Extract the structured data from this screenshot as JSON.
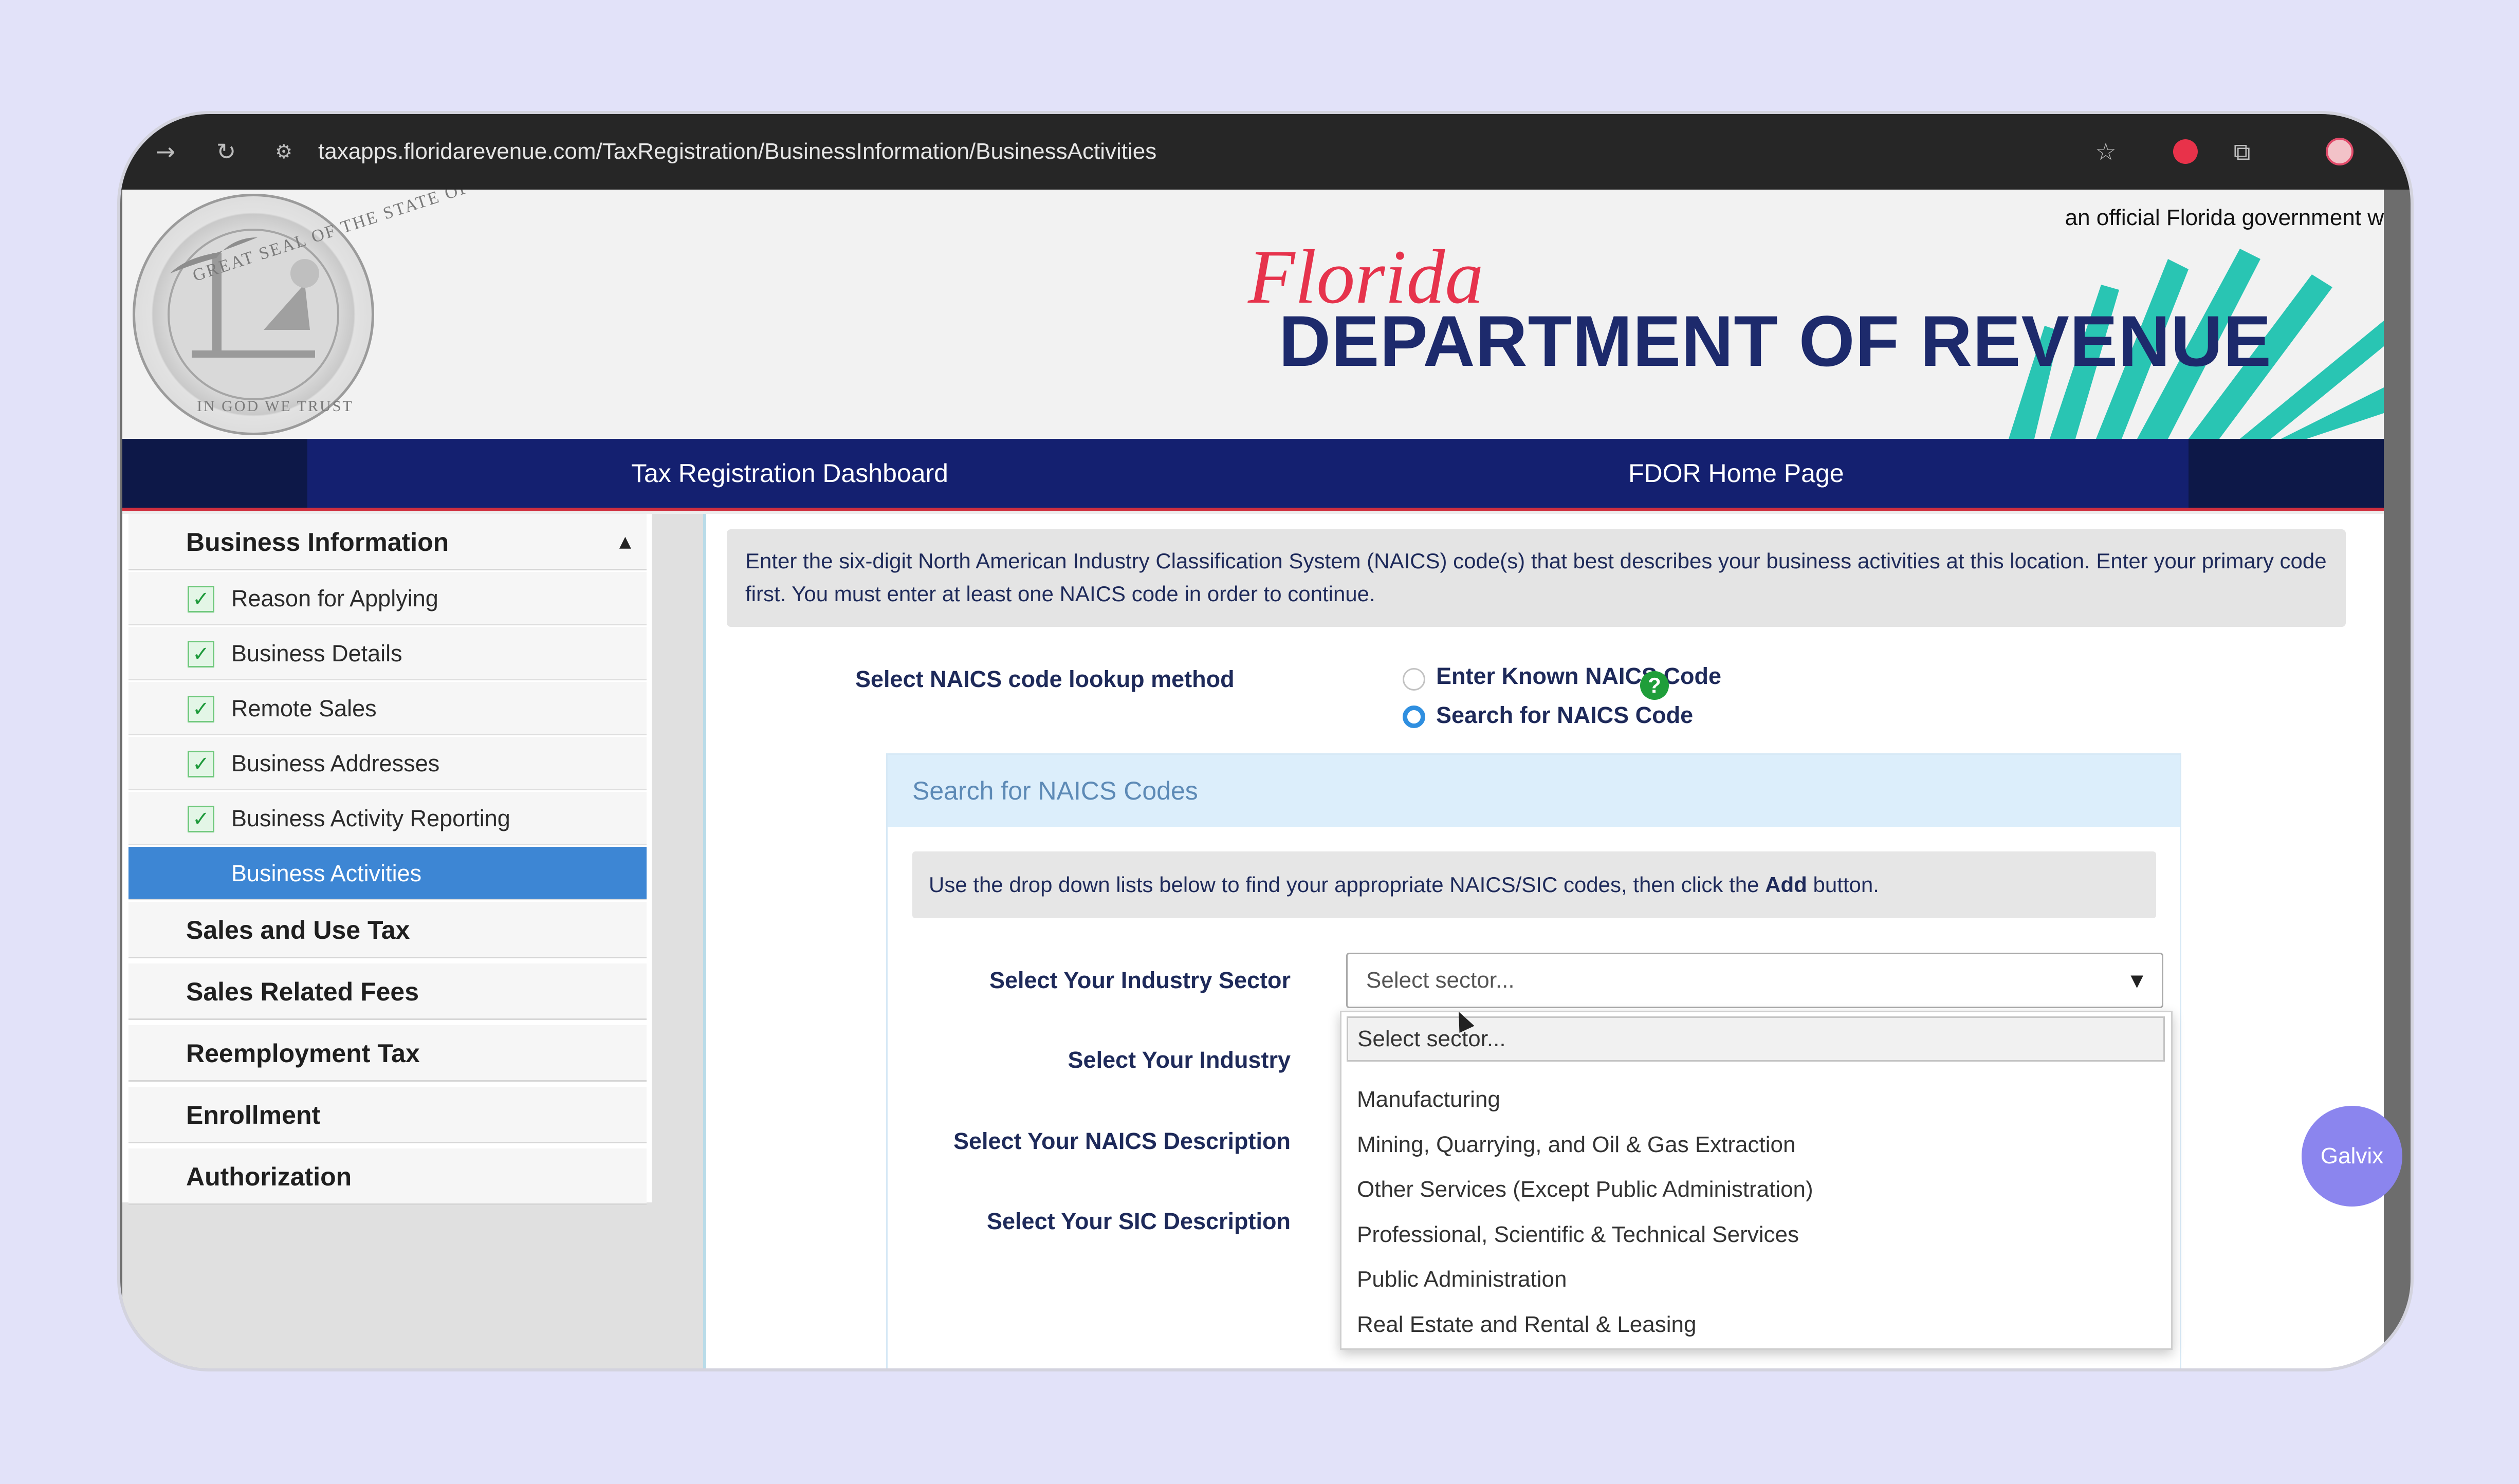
{
  "browser": {
    "url": "taxapps.floridarevenue.com/TaxRegistration/BusinessInformation/BusinessActivities",
    "icons": [
      "arrow-right-icon",
      "reload-icon",
      "site-settings-icon",
      "star-icon",
      "extension-red-icon",
      "puzzle-icon",
      "profile-avatar-icon"
    ]
  },
  "header": {
    "official_notice": "an official Florida government w",
    "logo_script": "Florida",
    "logo_title": "DEPARTMENT OF REVENUE",
    "seal_text_top": "GREAT SEAL OF THE STATE OF FLORIDA",
    "seal_text_bottom": "IN GOD WE TRUST"
  },
  "nav": {
    "dashboard": "Tax Registration Dashboard",
    "home": "FDOR Home Page"
  },
  "sidebar": {
    "section_title": "Business Information",
    "items": [
      {
        "label": "Reason for Applying",
        "checked": true
      },
      {
        "label": "Business Details",
        "checked": true
      },
      {
        "label": "Remote Sales",
        "checked": true
      },
      {
        "label": "Business Addresses",
        "checked": true
      },
      {
        "label": "Business Activity Reporting",
        "checked": true
      },
      {
        "label": "Business Activities",
        "active": true
      }
    ],
    "sections": [
      "Sales and Use Tax",
      "Sales Related Fees",
      "Reemployment Tax",
      "Enrollment",
      "Authorization"
    ]
  },
  "main": {
    "intro": "Enter the six-digit North American Industry Classification System (NAICS) code(s) that best describes your business activities at this location. Enter your primary code first. You must enter at least one NAICS code in order to continue.",
    "lookup_label": "Select NAICS code lookup method",
    "radio_known": "Enter Known NAICS Code",
    "radio_search": "Search for NAICS Code",
    "selected_method": "Search for NAICS Code",
    "help": "?",
    "panel_title": "Search for NAICS Codes",
    "hint_before": "Use the drop down lists below to find your appropriate NAICS/SIC codes, then click the ",
    "hint_bold": "Add",
    "hint_after": " button.",
    "labels": {
      "sector": "Select Your Industry Sector",
      "industry": "Select Your Industry",
      "naics": "Select Your NAICS Description",
      "sic": "Select Your SIC Description"
    },
    "sector_placeholder": "Select sector...",
    "dropdown_search": "Select sector...",
    "dropdown_options": [
      "Manufacturing",
      "Mining, Quarrying, and Oil & Gas Extraction",
      "Other Services (Except Public Administration)",
      "Professional, Scientific & Technical Services",
      "Public Administration",
      "Real Estate and Rental & Leasing"
    ]
  },
  "badge": "Galvix",
  "colors": {
    "nav_blue": "#142070",
    "nav_red_border": "#cf2f3e",
    "active_item": "#3d86d4",
    "radio_selected": "#2f8fe0",
    "panel_header": "#dceefb",
    "galvix": "#8b85ee",
    "logo_red": "#e6334c",
    "palm_teal": "#29c5b3"
  }
}
